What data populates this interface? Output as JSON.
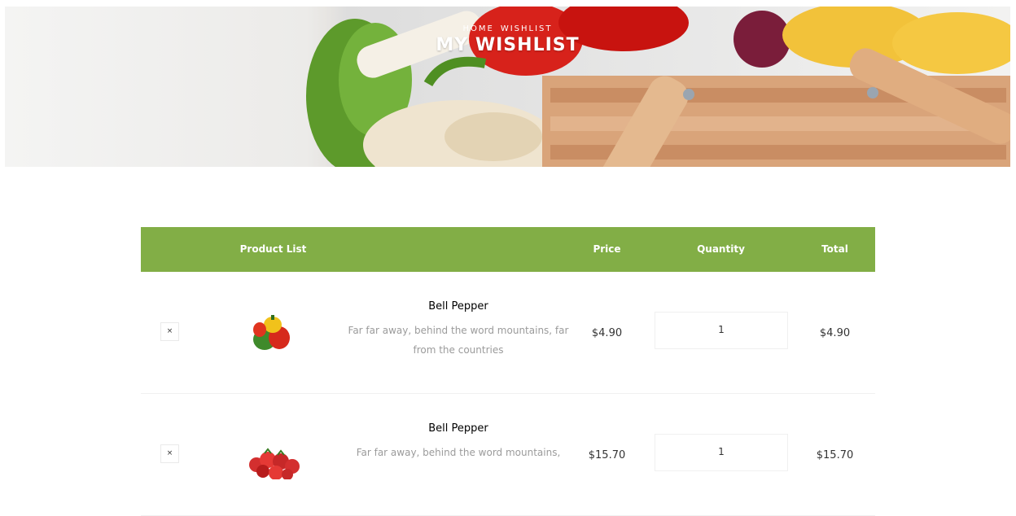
{
  "hero": {
    "breadcrumb_home": "Home",
    "breadcrumb_current": "Wishlist",
    "title": "My Wishlist"
  },
  "table": {
    "headers": {
      "product": "Product List",
      "price": "Price",
      "quantity": "Quantity",
      "total": "Total"
    },
    "rows": [
      {
        "remove": "×",
        "image": "bell-pepper-image",
        "name": "Bell Pepper",
        "description": "Far far away, behind the word mountains, far from the countries",
        "price": "$4.90",
        "quantity": "1",
        "total": "$4.90"
      },
      {
        "remove": "×",
        "image": "strawberries-image",
        "name": "Bell Pepper",
        "description": "Far far away, behind the word mountains,",
        "price": "$15.70",
        "quantity": "1",
        "total": "$15.70"
      }
    ]
  },
  "colors": {
    "accent": "#82ae46",
    "text_muted": "#9b9b9b"
  }
}
